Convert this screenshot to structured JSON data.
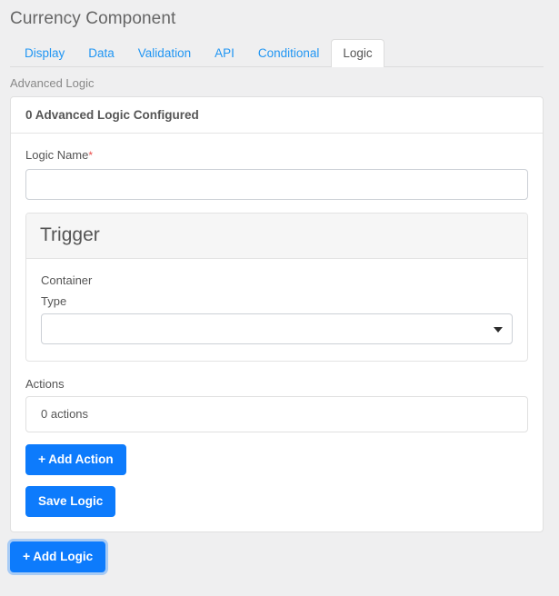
{
  "header": {
    "title": "Currency Component"
  },
  "tabs": [
    {
      "label": "Display",
      "active": false
    },
    {
      "label": "Data",
      "active": false
    },
    {
      "label": "Validation",
      "active": false
    },
    {
      "label": "API",
      "active": false
    },
    {
      "label": "Conditional",
      "active": false
    },
    {
      "label": "Logic",
      "active": true
    }
  ],
  "section": {
    "label": "Advanced Logic"
  },
  "panel": {
    "heading": "0 Advanced Logic Configured"
  },
  "form": {
    "logic_name_label": "Logic Name",
    "required_marker": "*",
    "logic_name_value": "",
    "logic_name_placeholder": ""
  },
  "trigger": {
    "title": "Trigger",
    "container_label": "Container",
    "type_label": "Type",
    "type_value": "",
    "type_options": [
      ""
    ]
  },
  "actions": {
    "label": "Actions",
    "summary": "0 actions",
    "add_action_label": "Add Action",
    "plus_glyph": "+"
  },
  "buttons": {
    "save_logic_label": "Save Logic",
    "add_logic_label": "Add Logic",
    "plus_glyph": "+"
  },
  "colors": {
    "accent_blue": "#0d7bfc",
    "tab_link_blue": "#2196f3",
    "required_red": "#eb4d4b",
    "page_bg": "#efeff0"
  }
}
